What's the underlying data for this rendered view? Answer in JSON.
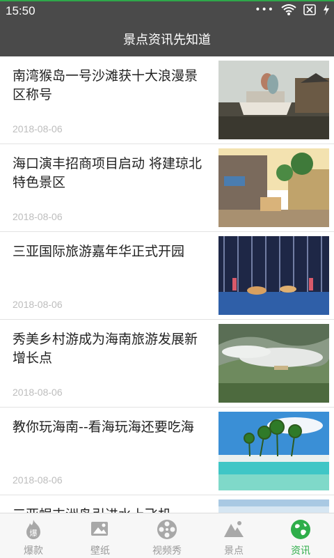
{
  "status_bar": {
    "time": "15:50"
  },
  "app_bar": {
    "title": "景点资讯先知道"
  },
  "news": [
    {
      "title": "南湾猴岛一号沙滩获十大浪漫景区称号",
      "date": "2018-08-06"
    },
    {
      "title": "海口演丰招商项目启动 将建琼北特色景区",
      "date": "2018-08-06"
    },
    {
      "title": "三亚国际旅游嘉年华正式开园",
      "date": "2018-08-06"
    },
    {
      "title": "秀美乡村游成为海南旅游发展新增长点",
      "date": "2018-08-06"
    },
    {
      "title": "教你玩海南--看海玩海还要吃海",
      "date": "2018-08-06"
    },
    {
      "title": "三亚蜈支洲岛引进水上飞机",
      "date": ""
    }
  ],
  "tabs": [
    {
      "label": "爆款",
      "icon": "fire-badge-icon"
    },
    {
      "label": "壁纸",
      "icon": "wallpaper-icon"
    },
    {
      "label": "视频秀",
      "icon": "film-reel-icon"
    },
    {
      "label": "景点",
      "icon": "mountain-icon"
    },
    {
      "label": "资讯",
      "icon": "globe-icon"
    }
  ],
  "active_tab": "资讯",
  "colors": {
    "header": "#4a4a4a",
    "accent": "#2fae4a",
    "inactive": "#9a9a9a",
    "date": "#bdbdbd"
  }
}
